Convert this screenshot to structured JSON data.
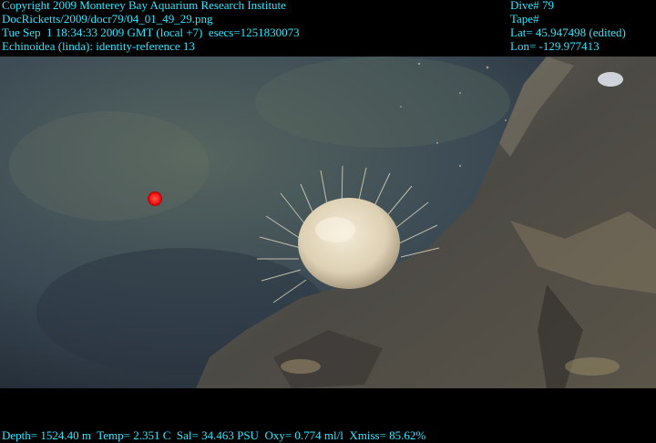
{
  "overlay": {
    "copyright": "Copyright 2009 Monterey Bay Aquarium Research Institute",
    "file_path": "DocRicketts/2009/docr79/04_01_49_29.png",
    "timestamp": "Tue Sep  1 18:34:33 2009 GMT (local +7)  esecs=1251830073",
    "identification": "Echinoidea (linda): identity-reference 13",
    "dive": "Dive# 79",
    "tape": "Tape#",
    "lat": "Lat= 45.947498 (edited)",
    "lon": "Lon= -129.977413",
    "sensors": "Depth= 1524.40 m  Temp= 2.351 C  Sal= 34.463 PSU  Oxy= 0.774 ml/l  Xmiss= 85.62%"
  },
  "colors": {
    "overlay_text": "#2fe8ff",
    "laser_dot": "#ff1a1a",
    "water": "#3d4a52",
    "rock": "#57524a",
    "urchin": "#e6dcc4"
  }
}
